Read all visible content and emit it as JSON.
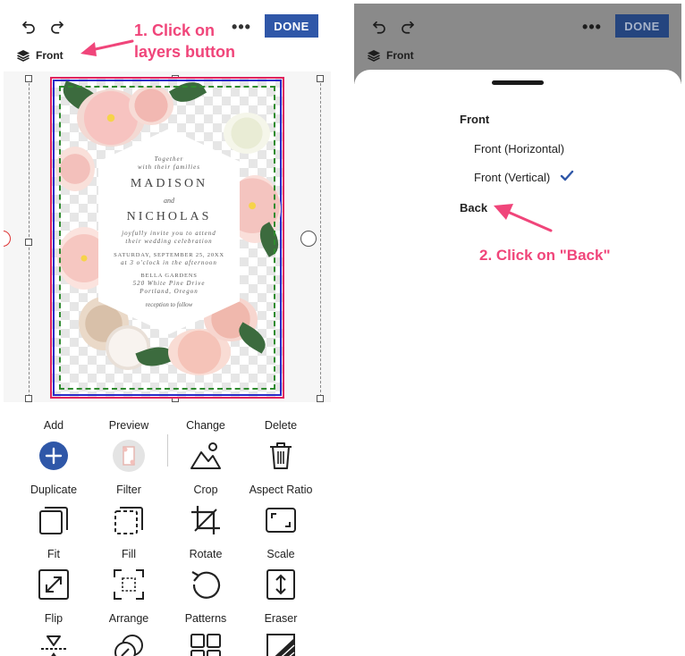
{
  "left_panel": {
    "toolbar": {
      "undo_icon": "undo-icon",
      "redo_icon": "redo-icon",
      "more_label": "•••",
      "done_label": "DONE",
      "layers_label": "Front"
    },
    "annotation": [
      "1. Click on",
      "layers button"
    ],
    "invitation": {
      "line1": "Together",
      "line2": "with their families",
      "name1": "MADISON",
      "and": "and",
      "name2": "NICHOLAS",
      "invite1": "joyfully invite you to attend",
      "invite2": "their wedding celebration",
      "date": "SATURDAY, SEPTEMBER 25, 20XX",
      "time": "at 3 o'clock in the afternoon",
      "venue1": "BELLA GARDENS",
      "venue2": "520 White Pine Drive",
      "venue3": "Portland, Oregon",
      "follow": "reception to follow"
    },
    "tools": [
      {
        "label": "Add",
        "icon": "plus-circle-icon"
      },
      {
        "label": "Preview",
        "icon": "preview-thumbnail-icon"
      },
      {
        "label": "Change",
        "icon": "image-mountain-icon"
      },
      {
        "label": "Delete",
        "icon": "trash-icon"
      },
      {
        "label": "Duplicate",
        "icon": "duplicate-icon"
      },
      {
        "label": "Filter",
        "icon": "filter-icon"
      },
      {
        "label": "Crop",
        "icon": "crop-icon"
      },
      {
        "label": "Aspect Ratio",
        "icon": "aspect-ratio-icon"
      },
      {
        "label": "Fit",
        "icon": "fit-icon"
      },
      {
        "label": "Fill",
        "icon": "fill-icon"
      },
      {
        "label": "Rotate",
        "icon": "rotate-icon"
      },
      {
        "label": "Scale",
        "icon": "scale-icon"
      },
      {
        "label": "Flip",
        "icon": "flip-icon"
      },
      {
        "label": "Arrange",
        "icon": "arrange-icon"
      },
      {
        "label": "Patterns",
        "icon": "patterns-icon"
      },
      {
        "label": "Eraser",
        "icon": "eraser-icon"
      }
    ],
    "accent_color": "#2f57a8"
  },
  "right_panel": {
    "toolbar": {
      "more_label": "•••",
      "done_label": "DONE",
      "layers_label": "Front"
    },
    "sheet": {
      "group1": "Front",
      "option1": "Front (Horizontal)",
      "option2": "Front (Vertical)",
      "selected": "Front (Vertical)",
      "group2": "Back"
    },
    "annotation": "2. Click on \"Back\""
  },
  "annotation_color": "#f0457a"
}
